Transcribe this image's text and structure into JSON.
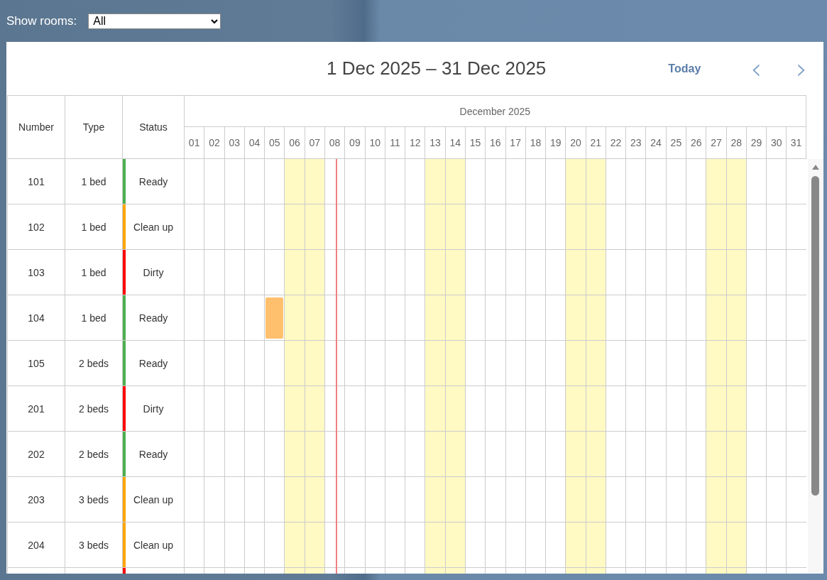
{
  "filter": {
    "label": "Show rooms:",
    "value": "All"
  },
  "calendar": {
    "range_title": "1 Dec 2025 – 31 Dec 2025",
    "today_button": "Today",
    "prev_button": "‹",
    "next_button": "›"
  },
  "table": {
    "columns": [
      "Number",
      "Type",
      "Status"
    ],
    "month": "December 2025",
    "days": [
      {
        "label": "01",
        "weekend": false
      },
      {
        "label": "02",
        "weekend": false
      },
      {
        "label": "03",
        "weekend": false
      },
      {
        "label": "04",
        "weekend": false
      },
      {
        "label": "05",
        "weekend": false
      },
      {
        "label": "06",
        "weekend": true
      },
      {
        "label": "07",
        "weekend": true
      },
      {
        "label": "08",
        "weekend": false,
        "today": true
      },
      {
        "label": "09",
        "weekend": false
      },
      {
        "label": "10",
        "weekend": false
      },
      {
        "label": "11",
        "weekend": false
      },
      {
        "label": "12",
        "weekend": false
      },
      {
        "label": "13",
        "weekend": true
      },
      {
        "label": "14",
        "weekend": true
      },
      {
        "label": "15",
        "weekend": false
      },
      {
        "label": "16",
        "weekend": false
      },
      {
        "label": "17",
        "weekend": false
      },
      {
        "label": "18",
        "weekend": false
      },
      {
        "label": "19",
        "weekend": false
      },
      {
        "label": "20",
        "weekend": true
      },
      {
        "label": "21",
        "weekend": true
      },
      {
        "label": "22",
        "weekend": false
      },
      {
        "label": "23",
        "weekend": false
      },
      {
        "label": "24",
        "weekend": false
      },
      {
        "label": "25",
        "weekend": false
      },
      {
        "label": "26",
        "weekend": false
      },
      {
        "label": "27",
        "weekend": true
      },
      {
        "label": "28",
        "weekend": true
      },
      {
        "label": "29",
        "weekend": false
      },
      {
        "label": "30",
        "weekend": false
      },
      {
        "label": "31",
        "weekend": false
      }
    ],
    "rows": [
      {
        "number": "101",
        "type": "1 bed",
        "status": "Ready",
        "color": "#4caf50"
      },
      {
        "number": "102",
        "type": "1 bed",
        "status": "Clean up",
        "color": "#ffa500"
      },
      {
        "number": "103",
        "type": "1 bed",
        "status": "Dirty",
        "color": "#ff0000"
      },
      {
        "number": "104",
        "type": "1 bed",
        "status": "Ready",
        "color": "#4caf50",
        "booked_days": [
          false,
          false,
          false,
          false,
          true
        ]
      },
      {
        "number": "105",
        "type": "2 beds",
        "status": "Ready",
        "color": "#4caf50"
      },
      {
        "number": "201",
        "type": "2 beds",
        "status": "Dirty",
        "color": "#ff0000"
      },
      {
        "number": "202",
        "type": "2 beds",
        "status": "Ready",
        "color": "#4caf50"
      },
      {
        "number": "203",
        "type": "3 beds",
        "status": "Clean up",
        "color": "#ffa500"
      },
      {
        "number": "204",
        "type": "3 beds",
        "status": "Clean up",
        "color": "#ffa500"
      },
      {
        "color": "#ff0000"
      }
    ]
  }
}
